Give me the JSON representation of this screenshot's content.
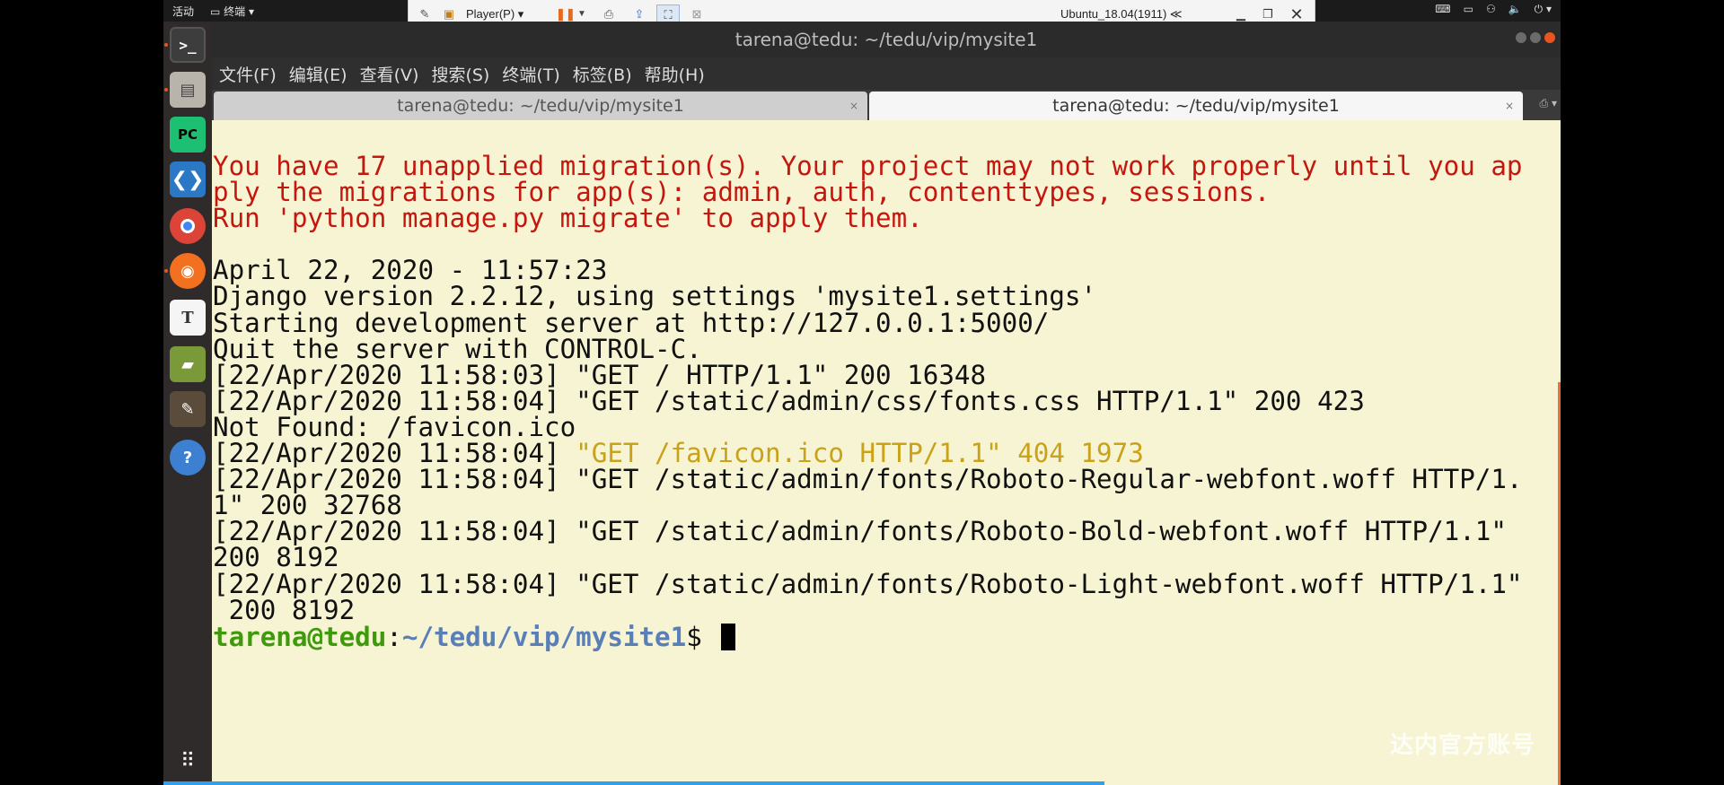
{
  "topbar": {
    "activities": "活动",
    "app_menu": "终端"
  },
  "vm_toolbar": {
    "player_label": "Player(P)",
    "vm_name": "Ubuntu_18.04(1911)",
    "collapse": "≪"
  },
  "window": {
    "title": "tarena@tedu: ~/tedu/vip/mysite1"
  },
  "menubar": [
    "文件(F)",
    "编辑(E)",
    "查看(V)",
    "搜索(S)",
    "终端(T)",
    "标签(B)",
    "帮助(H)"
  ],
  "tabs": [
    {
      "label": "tarena@tedu: ~/tedu/vip/mysite1",
      "active": false
    },
    {
      "label": "tarena@tedu: ~/tedu/vip/mysite1",
      "active": true
    }
  ],
  "terminal": {
    "warning_lines": [
      "You have 17 unapplied migration(s). Your project may not work properly until you ap",
      "ply the migrations for app(s): admin, auth, contenttypes, sessions.",
      "Run 'python manage.py migrate' to apply them."
    ],
    "lines": [
      "April 22, 2020 - 11:57:23",
      "Django version 2.2.12, using settings 'mysite1.settings'",
      "Starting development server at http://127.0.0.1:5000/",
      "Quit the server with CONTROL-C.",
      "[22/Apr/2020 11:58:03] \"GET / HTTP/1.1\" 200 16348",
      "[22/Apr/2020 11:58:04] \"GET /static/admin/css/fonts.css HTTP/1.1\" 200 423",
      "Not Found: /favicon.ico"
    ],
    "favicon_prefix": "[22/Apr/2020 11:58:04] ",
    "favicon_request": "\"GET /favicon.ico HTTP/1.1\" 404 1973",
    "lines_after": [
      "[22/Apr/2020 11:58:04] \"GET /static/admin/fonts/Roboto-Regular-webfont.woff HTTP/1.",
      "1\" 200 32768",
      "[22/Apr/2020 11:58:04] \"GET /static/admin/fonts/Roboto-Bold-webfont.woff HTTP/1.1\"",
      "200 8192",
      "[22/Apr/2020 11:58:04] \"GET /static/admin/fonts/Roboto-Light-webfont.woff HTTP/1.1\"",
      " 200 8192"
    ],
    "prompt_user": "tarena@tedu",
    "prompt_sep": ":",
    "prompt_path": "~/tedu/vip/mysite1",
    "prompt_symbol": "$ "
  },
  "watermark": "达内官方账号",
  "colors": {
    "terminal_bg": "#f6f4d2",
    "warning_red": "#c4170f",
    "http_404_yellow": "#c9a21a",
    "prompt_green": "#3e9a0c",
    "prompt_blue": "#5a7fb8",
    "accent_orange": "#e95420"
  },
  "dock_icons": [
    "terminal-icon",
    "files-icon",
    "pycharm-icon",
    "vscode-icon",
    "chrome-icon",
    "firefox-icon",
    "text-editor-icon",
    "book-icon",
    "paint-icon",
    "help-icon"
  ]
}
